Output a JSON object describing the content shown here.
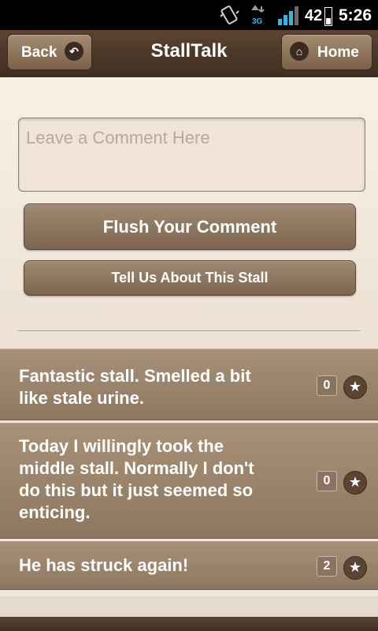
{
  "status_bar": {
    "battery_level": "42",
    "time": "5:26",
    "network_type": "3G",
    "icons": [
      "vibrate-icon",
      "network-3g-icon",
      "signal-icon",
      "battery-icon"
    ]
  },
  "header": {
    "title": "StallTalk",
    "back_label": "Back",
    "home_label": "Home",
    "back_icon": "undo-arrow-icon",
    "home_icon": "house-icon"
  },
  "form": {
    "comment_placeholder": "Leave a Comment Here",
    "comment_value": "",
    "flush_label": "Flush Your Comment",
    "tell_label": "Tell Us About This Stall"
  },
  "comments": [
    {
      "text": "Fantastic stall. Smelled a bit like stale urine.",
      "count": "0"
    },
    {
      "text": "Today I willingly took the middle stall. Normally I don't do this but it just seemed so enticing.",
      "count": "0"
    },
    {
      "text": "He has struck again!",
      "count": "2"
    }
  ],
  "colors": {
    "header_bg": "#4d3828",
    "button_bg": "#8f785f",
    "page_bg": "#f5ede2",
    "row_bg": "#9c8670",
    "text_light": "#ffffff"
  }
}
